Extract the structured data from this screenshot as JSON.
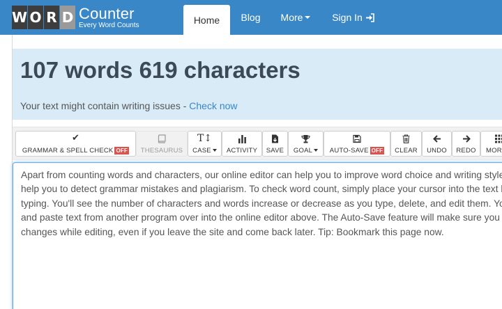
{
  "logo": {
    "letters": [
      "W",
      "O",
      "R",
      "D"
    ],
    "counter": "Counter",
    "tagline": "Every Word Counts"
  },
  "nav": {
    "home": "Home",
    "blog": "Blog",
    "more": "More",
    "signin": "Sign In"
  },
  "stats": {
    "counts": "107 words 619 characters",
    "issues_prefix": "Your text might contain writing issues - ",
    "issues_link": "Check now"
  },
  "toolbar": {
    "grammar": "GRAMMAR & SPELL CHECK",
    "grammar_badge": "OFF",
    "thesaurus": "THESAURUS",
    "case": "CASE",
    "activity": "ACTIVITY",
    "save": "SAVE",
    "goal": "GOAL",
    "autosave": "AUTO-SAVE",
    "autosave_badge": "OFF",
    "clear": "CLEAR",
    "undo": "UNDO",
    "redo": "REDO",
    "more": "MORE"
  },
  "editor": {
    "lines": [
      "Apart from counting words and characters, our online editor can help you to improve word choice and writing style, and, optionally,",
      "help you to detect grammar mistakes and plagiarism. To check word count, simply place your cursor into the text box above and start",
      "typing. You'll see the number of characters and words increase or decrease as you type, delete, and edit them. You can also copy",
      "and paste text from another program over into the online editor above. The Auto-Save feature will make sure you won't lose any",
      "changes while editing, even if you leave the site and come back later. Tip: Bookmark this page now."
    ]
  },
  "colors": {
    "navbar": "#3a87c8",
    "jumbotron": "#d9ebf7",
    "badge_off": "#d9534f"
  }
}
